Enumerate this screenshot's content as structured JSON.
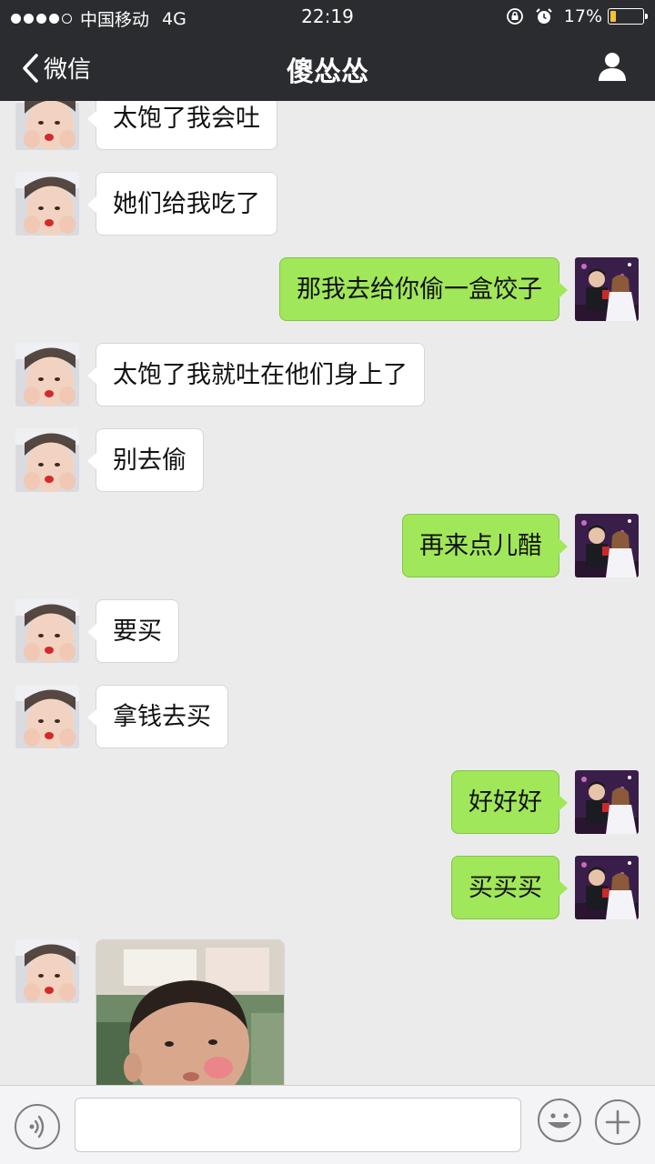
{
  "status_bar": {
    "carrier": "中国移动",
    "network": "4G",
    "time": "22:19",
    "battery_percent": "17%",
    "signal_bars_filled": 4,
    "signal_bars_total": 5,
    "battery_level": 0.17
  },
  "nav": {
    "back_label": "微信",
    "title": "傻怂怂",
    "icons": {
      "back": "chevron-left-icon",
      "profile": "person-icon"
    }
  },
  "messages": [
    {
      "side": "in",
      "text": "太饱了我会吐"
    },
    {
      "side": "in",
      "text": "她们给我吃了"
    },
    {
      "side": "out",
      "text": "那我去给你偷一盒饺子"
    },
    {
      "side": "in",
      "text": "太饱了我就吐在他们身上了"
    },
    {
      "side": "in",
      "text": "别去偷"
    },
    {
      "side": "out",
      "text": "再来点儿醋"
    },
    {
      "side": "in",
      "text": "要买"
    },
    {
      "side": "in",
      "text": "拿钱去买"
    },
    {
      "side": "out",
      "text": "好好好"
    },
    {
      "side": "out",
      "text": "买买买"
    },
    {
      "side": "in",
      "type": "sticker"
    }
  ],
  "input_bar": {
    "text_value": "",
    "icons": {
      "voice": "voice-icon",
      "emoji": "emoji-icon",
      "more": "plus-icon"
    }
  },
  "colors": {
    "nav_bg": "#2b2c30",
    "chat_bg": "#ebebeb",
    "incoming_bubble": "#ffffff",
    "outgoing_bubble": "#a0e75a",
    "battery_fill": "#f6c033"
  }
}
